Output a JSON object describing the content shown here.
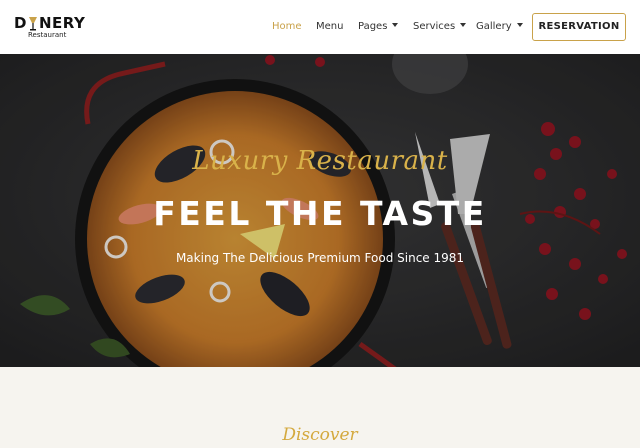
{
  "header": {
    "logo": {
      "text_left": "D",
      "text_right": "NERY",
      "sub": "Restaurant"
    },
    "nav": [
      {
        "label": "Home",
        "active": true,
        "dropdown": false
      },
      {
        "label": "Menu",
        "active": false,
        "dropdown": false
      },
      {
        "label": "Pages",
        "active": false,
        "dropdown": true
      },
      {
        "label": "Services",
        "active": false,
        "dropdown": true
      },
      {
        "label": "Gallery",
        "active": false,
        "dropdown": true
      }
    ],
    "cta_label": "RESERVATION"
  },
  "hero": {
    "script_title": "Luxury Restaurant",
    "title": "FEEL THE TASTE",
    "subtitle": "Making The Delicious Premium Food Since 1981"
  },
  "discover": {
    "label": "Discover"
  },
  "colors": {
    "accent": "#c9a24a",
    "hero_bg": "#2b2b2c",
    "section_bg": "#f6f4ef"
  }
}
